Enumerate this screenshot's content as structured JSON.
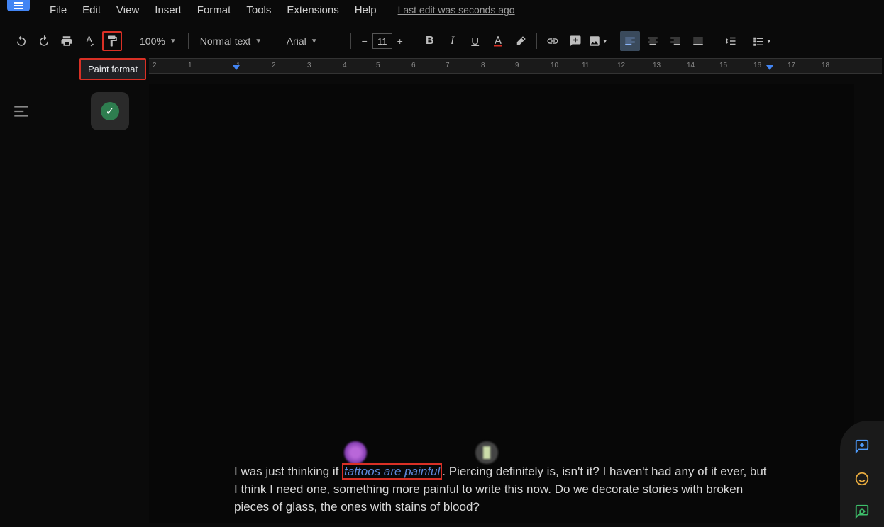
{
  "app_icon": "docs-icon",
  "menubar": {
    "items": [
      "File",
      "Edit",
      "View",
      "Insert",
      "Format",
      "Tools",
      "Extensions",
      "Help"
    ],
    "last_edit": "Last edit was seconds ago"
  },
  "toolbar": {
    "zoom": "100%",
    "style": "Normal text",
    "font": "Arial",
    "font_size": "11",
    "tooltip": "Paint format"
  },
  "ruler": {
    "numbers": [
      2,
      1,
      1,
      2,
      3,
      4,
      5,
      6,
      7,
      8,
      9,
      10,
      11,
      12,
      13,
      14,
      15,
      16,
      17,
      18
    ]
  },
  "document": {
    "text_pre": "I was just thinking if ",
    "text_highlight": "tattoos are painful",
    "text_post": ". Piercing definitely is, isn't it? I haven't had any of it ever, but I think I need one, something more painful to write this now. Do we decorate stories with broken pieces of glass, the ones with stains of blood?"
  }
}
